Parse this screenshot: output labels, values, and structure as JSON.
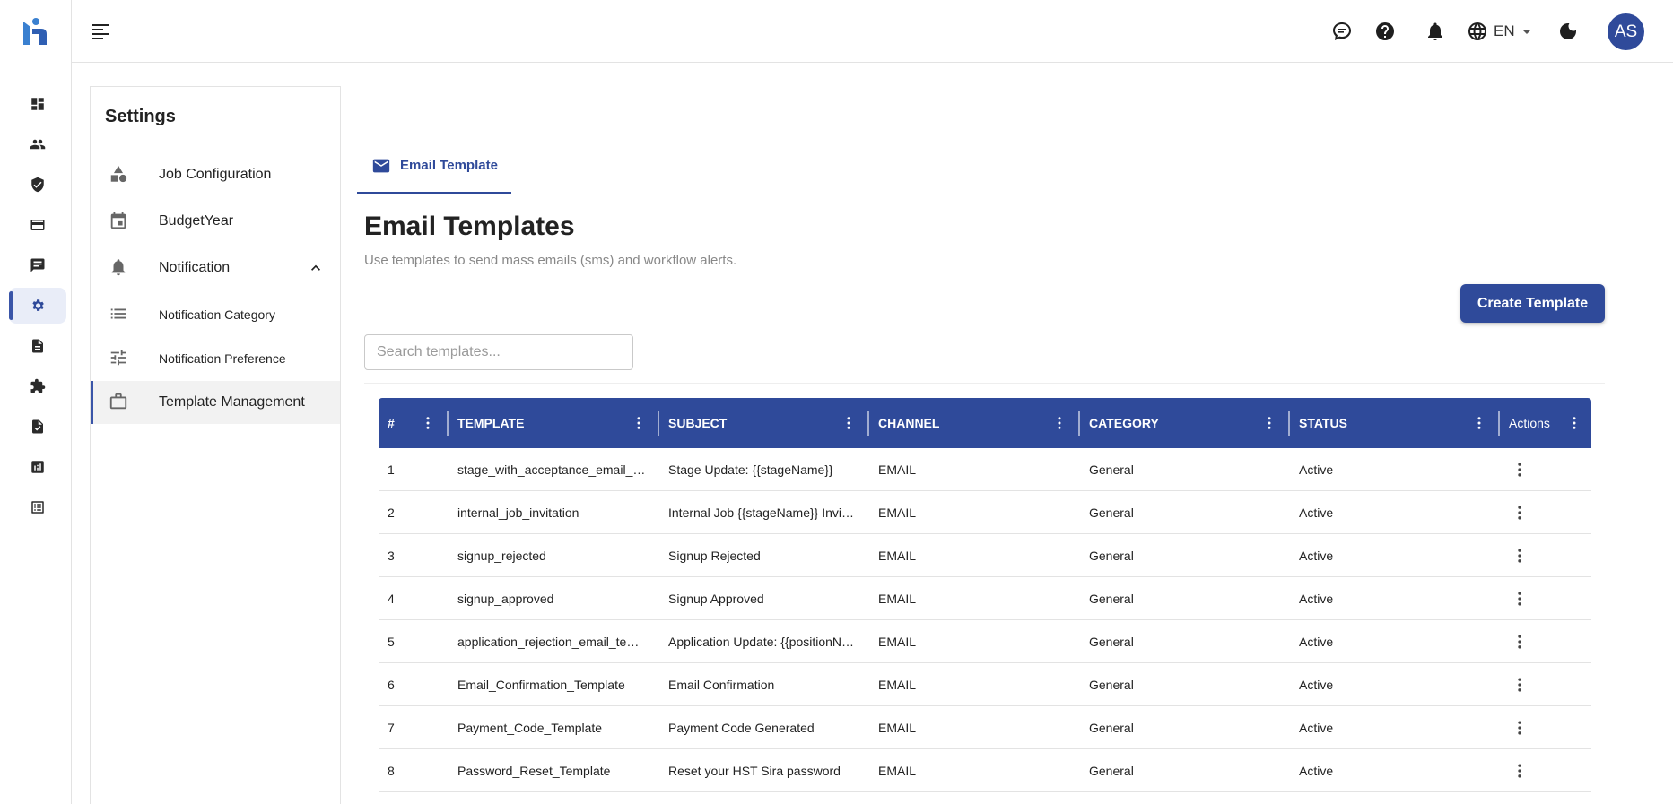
{
  "rail": {
    "items": [
      {
        "name": "dashboard-icon"
      },
      {
        "name": "people-icon"
      },
      {
        "name": "shield-check-icon"
      },
      {
        "name": "credit-card-icon"
      },
      {
        "name": "chat-icon"
      },
      {
        "name": "settings-gear-icon"
      },
      {
        "name": "document-icon"
      },
      {
        "name": "puzzle-icon"
      },
      {
        "name": "document-check-icon"
      },
      {
        "name": "analytics-icon"
      },
      {
        "name": "list-alt-icon"
      }
    ],
    "active_index": 5
  },
  "topbar": {
    "language": "EN",
    "avatar_initials": "AS"
  },
  "settings": {
    "title": "Settings",
    "items": [
      {
        "label": "Job Configuration",
        "icon": "category-shapes-icon"
      },
      {
        "label": "BudgetYear",
        "icon": "calendar-icon"
      },
      {
        "label": "Notification",
        "icon": "bell-icon"
      },
      {
        "label": "Notification Category",
        "icon": "list-icon"
      },
      {
        "label": "Notification Preference",
        "icon": "tune-icon"
      },
      {
        "label": "Template Management",
        "icon": "briefcase-icon"
      }
    ]
  },
  "tab": {
    "label": "Email Template"
  },
  "page": {
    "title": "Email Templates",
    "subtitle": "Use templates to send mass emails (sms) and workflow alerts.",
    "create_label": "Create Template",
    "search_placeholder": "Search templates..."
  },
  "table": {
    "columns": [
      "#",
      "TEMPLATE",
      "SUBJECT",
      "CHANNEL",
      "CATEGORY",
      "STATUS",
      "Actions"
    ],
    "rows": [
      [
        "1",
        "stage_with_acceptance_email_template",
        "Stage Update: {{stageName}}",
        "EMAIL",
        "General",
        "Active"
      ],
      [
        "2",
        "internal_job_invitation",
        "Internal Job {{stageName}} Invitation",
        "EMAIL",
        "General",
        "Active"
      ],
      [
        "3",
        "signup_rejected",
        "Signup Rejected",
        "EMAIL",
        "General",
        "Active"
      ],
      [
        "4",
        "signup_approved",
        "Signup Approved",
        "EMAIL",
        "General",
        "Active"
      ],
      [
        "5",
        "application_rejection_email_template",
        "Application Update: {{positionName}}",
        "EMAIL",
        "General",
        "Active"
      ],
      [
        "6",
        "Email_Confirmation_Template",
        "Email Confirmation",
        "EMAIL",
        "General",
        "Active"
      ],
      [
        "7",
        "Payment_Code_Template",
        "Payment Code Generated",
        "EMAIL",
        "General",
        "Active"
      ],
      [
        "8",
        "Password_Reset_Template",
        "Reset your HST Sira password",
        "EMAIL",
        "General",
        "Active"
      ]
    ]
  },
  "colors": {
    "primary": "#2f4a9a",
    "header_text": "#ffffff",
    "active_nav_bg": "#f2f2f2"
  }
}
